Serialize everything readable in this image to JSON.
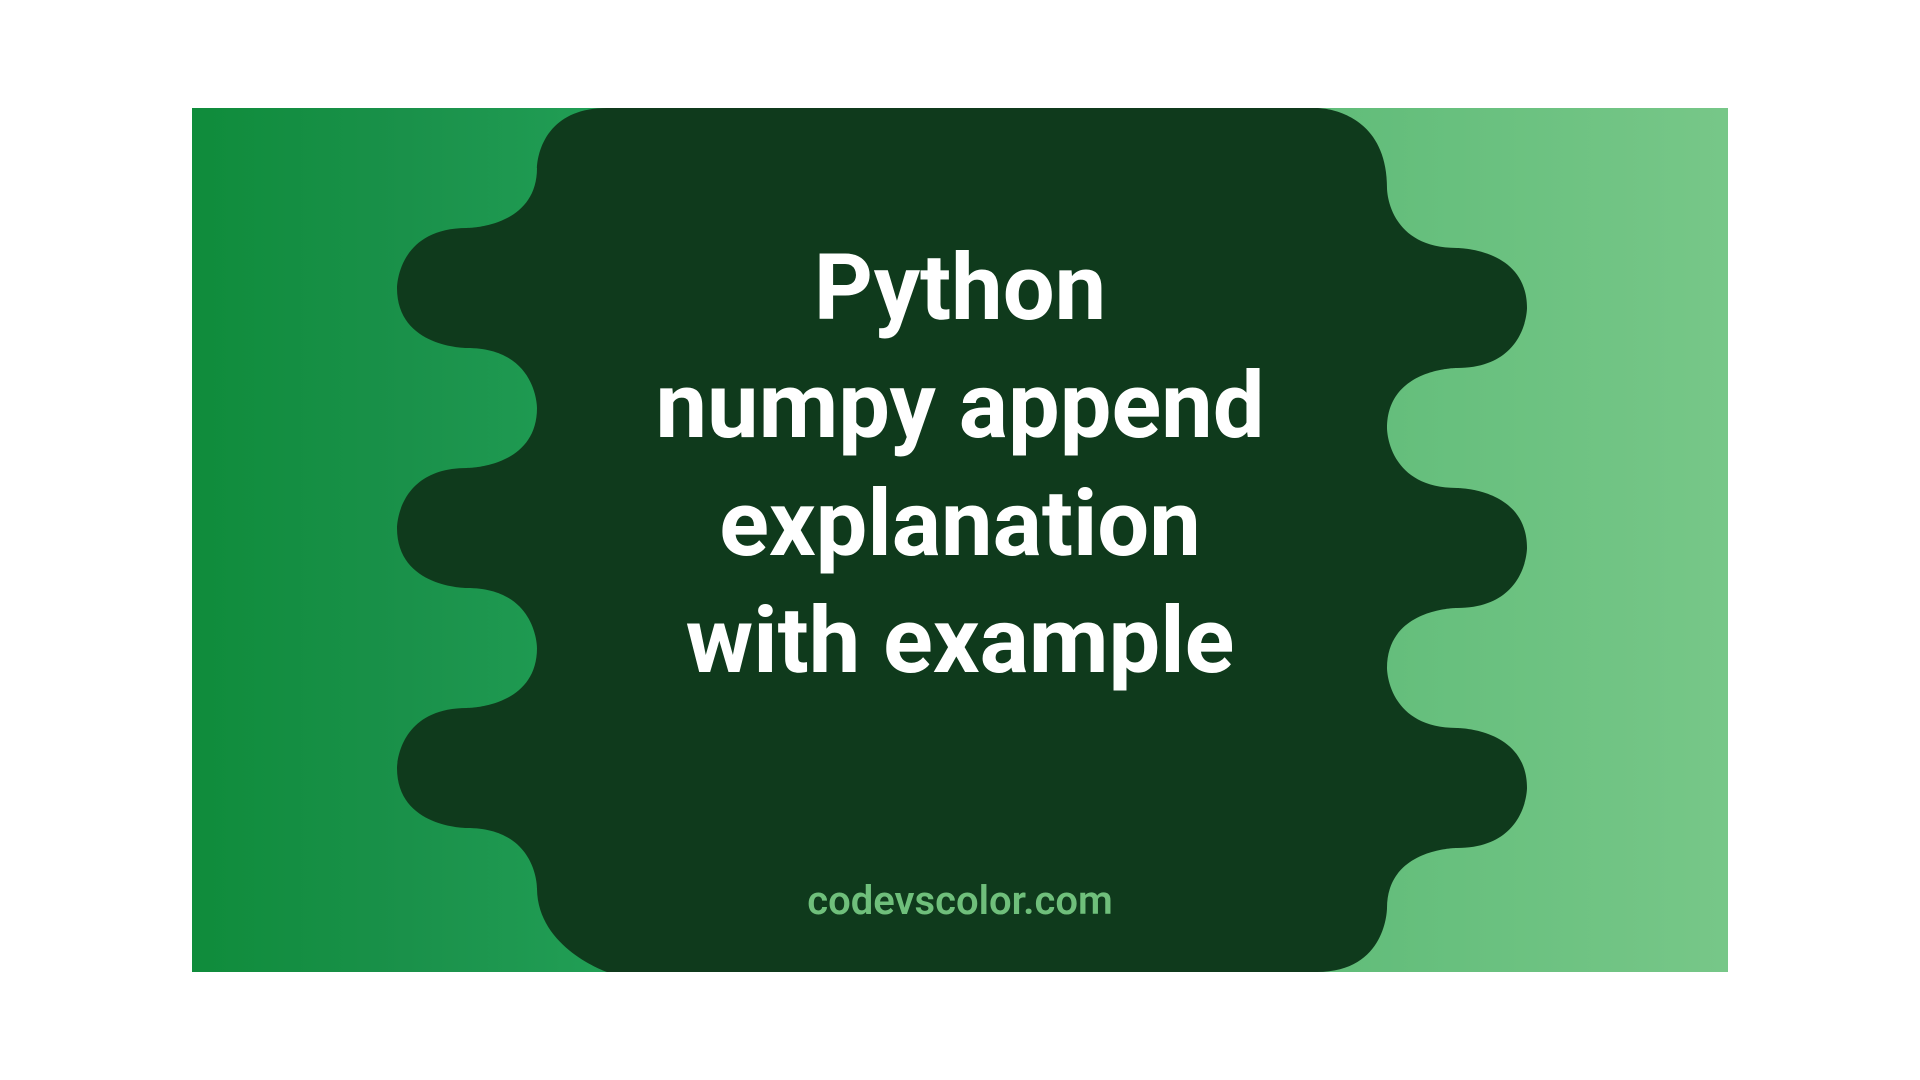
{
  "banner": {
    "title_lines": [
      "Python",
      "numpy append",
      "explanation",
      "with example"
    ],
    "site_name": "codevscolor.com"
  },
  "colors": {
    "blob_bg": "#0f3a1c",
    "left_edge_green": "#0f8c3b",
    "right_edge_green": "#77c788",
    "site_name_text": "#6fbf7b",
    "title_text": "#ffffff"
  }
}
